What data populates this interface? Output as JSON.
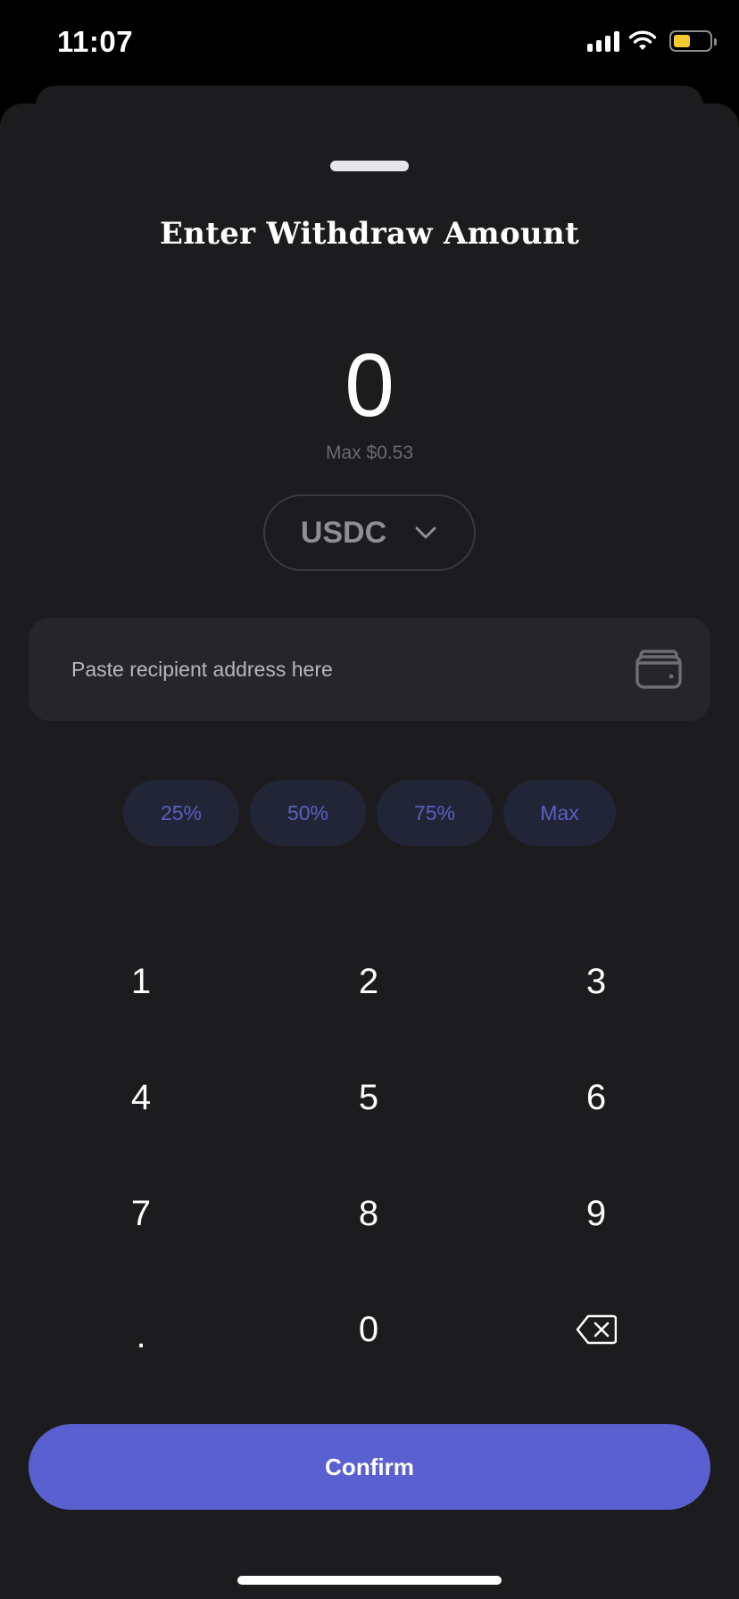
{
  "status_bar": {
    "time": "11:07",
    "battery_level": 0.45,
    "battery_color": "#f4cb2f"
  },
  "sheet": {
    "title": "Enter Withdraw Amount"
  },
  "amount": {
    "value": "0",
    "max_hint": "Max $0.53"
  },
  "token_selector": {
    "label": "USDC",
    "icon": "chevron-down-icon"
  },
  "recipient": {
    "placeholder": "Paste recipient address here",
    "value": "",
    "icon": "wallet-icon"
  },
  "quick_amounts": [
    "25%",
    "50%",
    "75%",
    "Max"
  ],
  "keypad": {
    "rows": [
      [
        "1",
        "2",
        "3"
      ],
      [
        "4",
        "5",
        "6"
      ],
      [
        "7",
        "8",
        "9"
      ],
      [
        ".",
        "0",
        "backspace"
      ]
    ],
    "backspace_icon": "backspace-icon"
  },
  "confirm_label": "Confirm",
  "colors": {
    "accent": "#5b60d1",
    "background": "#1c1c1e",
    "field": "#26262a",
    "chip_bg": "#222536",
    "chip_text": "#5a5fc4"
  }
}
